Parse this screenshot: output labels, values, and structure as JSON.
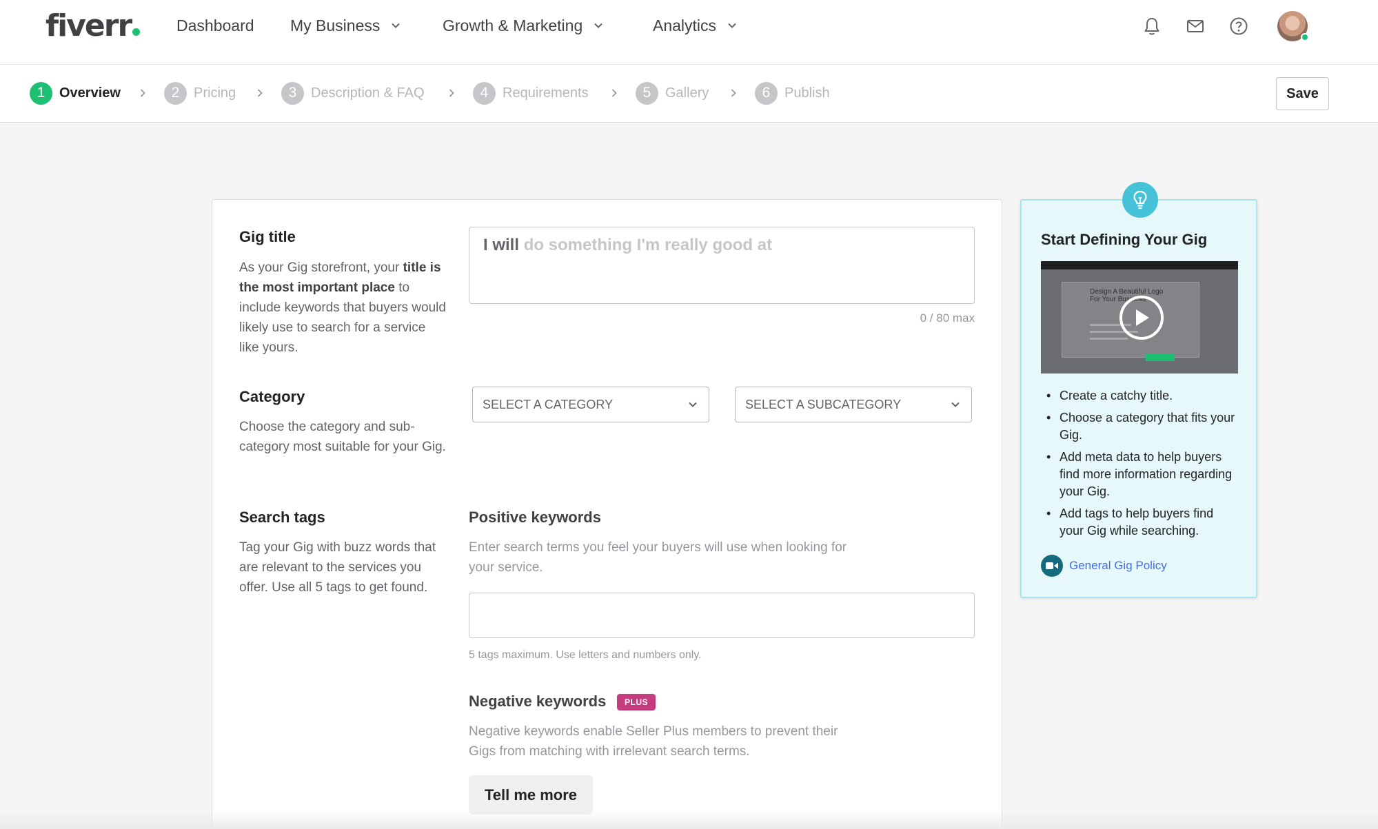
{
  "brand": {
    "logo_text": "fiverr",
    "dot_color": "#1dbf73"
  },
  "nav": {
    "items": [
      {
        "label": "Dashboard",
        "has_dropdown": false
      },
      {
        "label": "My Business",
        "has_dropdown": true
      },
      {
        "label": "Growth & Marketing",
        "has_dropdown": true
      },
      {
        "label": "Analytics",
        "has_dropdown": true
      }
    ],
    "icons": [
      "bell-icon",
      "mail-icon",
      "help-icon"
    ],
    "avatar": {
      "online": true
    }
  },
  "steps": {
    "items": [
      {
        "number": "1",
        "label": "Overview",
        "active": true
      },
      {
        "number": "2",
        "label": "Pricing",
        "active": false
      },
      {
        "number": "3",
        "label": "Description & FAQ",
        "active": false
      },
      {
        "number": "4",
        "label": "Requirements",
        "active": false
      },
      {
        "number": "5",
        "label": "Gallery",
        "active": false
      },
      {
        "number": "6",
        "label": "Publish",
        "active": false
      }
    ],
    "save_label": "Save"
  },
  "form": {
    "gig_title": {
      "label": "Gig title",
      "desc_part1": "As your Gig storefront, your",
      "desc_bold": "title is the most important place",
      "desc_part2": "to include keywords that buyers would likely use to search for a service like yours.",
      "prefix": "I will",
      "placeholder": "do something I'm really good at",
      "counter": "0 / 80 max"
    },
    "category": {
      "label": "Category",
      "desc": "Choose the category and sub-category most suitable for your Gig.",
      "select_category": "SELECT A CATEGORY",
      "select_subcategory": "SELECT A SUBCATEGORY"
    },
    "search_tags": {
      "label": "Search tags",
      "desc": "Tag your Gig with buzz words that are relevant to the services you offer. Use all 5 tags to get found.",
      "positive_label": "Positive keywords",
      "positive_desc": "Enter search terms you feel your buyers will use when looking for your service.",
      "tags_note": "5 tags maximum. Use letters and numbers only.",
      "negative_label": "Negative keywords",
      "plus_badge": "PLUS",
      "negative_desc": "Negative keywords enable Seller Plus members to prevent their Gigs from matching with irrelevant search terms.",
      "tell_more": "Tell me more"
    }
  },
  "side_panel": {
    "title": "Start Defining Your Gig",
    "video_caption": "Design A Beautiful Logo For Your Business",
    "tips": [
      "Create a catchy title.",
      "Choose a category that fits your Gig.",
      "Add meta data to help buyers find more information regarding your Gig.",
      "Add tags to help buyers find your Gig while searching."
    ],
    "policy_link": "General Gig Policy",
    "accent_color": "#45c2d8"
  }
}
